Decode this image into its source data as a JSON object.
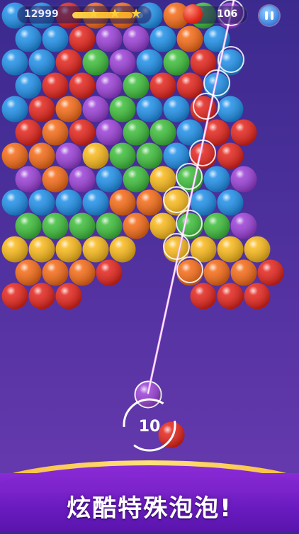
{
  "hud": {
    "score": "12999",
    "progress_fraction": 0.85,
    "stars_earned": 3,
    "coins": "106"
  },
  "shooter": {
    "shots_left": "10",
    "loaded_color": "purple",
    "next_color": "red"
  },
  "footer": {
    "slogan": "炫酷特殊泡泡!"
  },
  "icons": {
    "coin": "coin-icon",
    "pause": "pause-icon",
    "star": "star-icon",
    "swap": "swap-arrows-icon"
  },
  "colors": {
    "R": "#e3241b",
    "O": "#f46a16",
    "Y": "#f8b81a",
    "G": "#3dbd3a",
    "B": "#1f8fe8",
    "P": "#9a3fd6",
    "aim_line": "#f1a8ff"
  },
  "board_rows": [
    "BBROOBOGP",
    "BBRPPBOB",
    "BBRGPBGRB",
    "BRRPGRRB",
    "BROPGBBRB",
    "RORPGGBRR",
    "OOPYGGBRR",
    "POPBGYGBP",
    "BBBBOOYBB",
    "GGGGOYGGP",
    "YYYYY-YYYY",
    "OOOR--OOOR",
    "RRR----RRR"
  ]
}
